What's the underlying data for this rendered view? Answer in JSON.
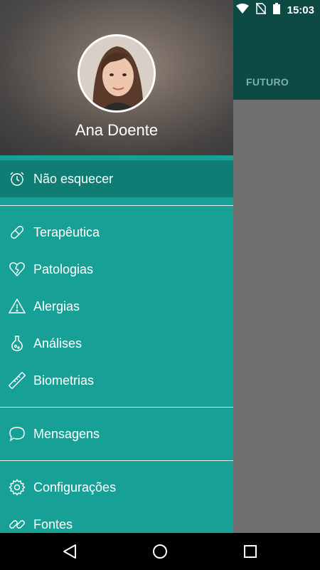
{
  "status_bar": {
    "time": "15:03"
  },
  "background": {
    "tab_label": "FUTURO"
  },
  "drawer": {
    "user_name": "Ana Doente",
    "selected_item": {
      "label": "Não esquecer",
      "icon": "alarm-clock-icon"
    },
    "group1": [
      {
        "label": "Terapêutica",
        "icon": "pill-icon"
      },
      {
        "label": "Patologias",
        "icon": "broken-heart-icon"
      },
      {
        "label": "Alergias",
        "icon": "warning-icon"
      },
      {
        "label": "Análises",
        "icon": "flask-icon"
      },
      {
        "label": "Biometrias",
        "icon": "ruler-icon"
      }
    ],
    "group2": [
      {
        "label": "Mensagens",
        "icon": "chat-bubble-icon"
      }
    ],
    "group3": [
      {
        "label": "Configurações",
        "icon": "gear-icon"
      },
      {
        "label": "Fontes",
        "icon": "link-icon"
      }
    ]
  },
  "colors": {
    "drawer": "#17a095",
    "selected": "#0f7d73",
    "toolbar": "#0d4a43"
  }
}
